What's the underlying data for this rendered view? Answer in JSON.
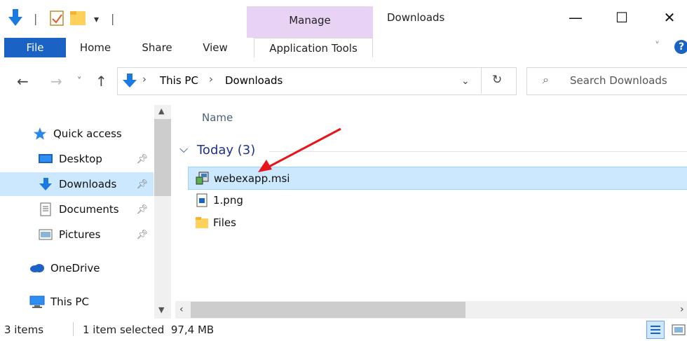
{
  "titlebar": {
    "qat_separators": [
      "|",
      "|"
    ],
    "manage_label": "Manage",
    "window_title": "Downloads",
    "minimize": "—",
    "maximize": "☐",
    "close": "✕"
  },
  "ribbon": {
    "tabs": [
      "File",
      "Home",
      "Share",
      "View",
      "Application Tools"
    ],
    "help": "?",
    "collapse": "˅"
  },
  "address": {
    "crumbs": [
      "This PC",
      "Downloads"
    ],
    "separator": "›",
    "search_placeholder": "Search Downloads"
  },
  "nav": {
    "items": [
      {
        "label": "Quick access"
      },
      {
        "label": "Desktop",
        "pinned": true
      },
      {
        "label": "Downloads",
        "pinned": true,
        "selected": true
      },
      {
        "label": "Documents",
        "pinned": true
      },
      {
        "label": "Pictures",
        "pinned": true
      },
      {
        "label": "OneDrive"
      },
      {
        "label": "This PC"
      }
    ]
  },
  "content": {
    "column_name": "Name",
    "group_label": "Today (3)",
    "files": [
      {
        "name": "webexapp.msi",
        "selected": true,
        "icon": "msi-installer-icon"
      },
      {
        "name": "1.png",
        "icon": "image-file-icon"
      },
      {
        "name": "Files",
        "icon": "folder-icon"
      }
    ]
  },
  "status": {
    "items_count": "3 items",
    "selection": "1 item selected  97,4 MB"
  },
  "colors": {
    "accent": "#1a62c3",
    "selection": "#cce8ff",
    "manage_tab": "#e8d3f5",
    "arrow": "#e8141b"
  }
}
